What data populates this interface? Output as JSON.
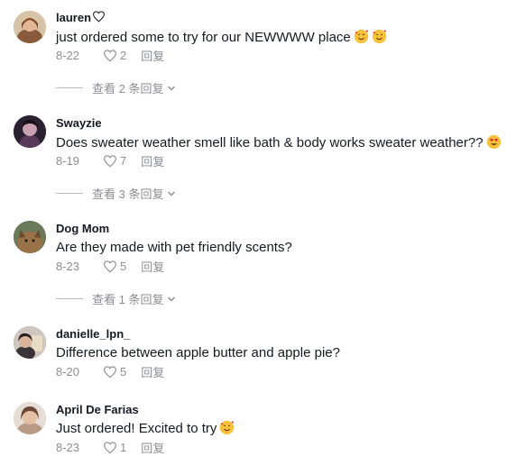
{
  "comments": [
    {
      "username": "lauren",
      "text": "just ordered some to try for our NEWWWW place",
      "date": "8-22",
      "likes": "2",
      "reply_label": "回复",
      "view_replies": "查看 2 条回复",
      "avatar_color": "#c9a27a"
    },
    {
      "username": "Swayzie",
      "text": "Does sweater weather smell like bath & body works sweater weather??",
      "date": "8-19",
      "likes": "7",
      "reply_label": "回复",
      "view_replies": "查看 3 条回复",
      "avatar_color": "#3a2a3a"
    },
    {
      "username": "Dog Mom",
      "text": "Are they made with pet friendly scents?",
      "date": "8-23",
      "likes": "5",
      "reply_label": "回复",
      "view_replies": "查看 1 条回复",
      "avatar_color": "#8a6a44"
    },
    {
      "username": "danielle_lpn_",
      "text": "Difference between apple butter and apple pie?",
      "date": "8-20",
      "likes": "5",
      "reply_label": "回复",
      "avatar_color": "#5a4a44"
    },
    {
      "username": "April De Farias",
      "text": "Just ordered! Excited to try",
      "date": "8-23",
      "likes": "1",
      "reply_label": "回复",
      "avatar_color": "#c9a890"
    }
  ],
  "colors": {
    "text_primary": "#161823",
    "text_secondary": "#8a8b91",
    "emoji_face": "#f7c23a",
    "heart_eye": "#e8263a"
  }
}
